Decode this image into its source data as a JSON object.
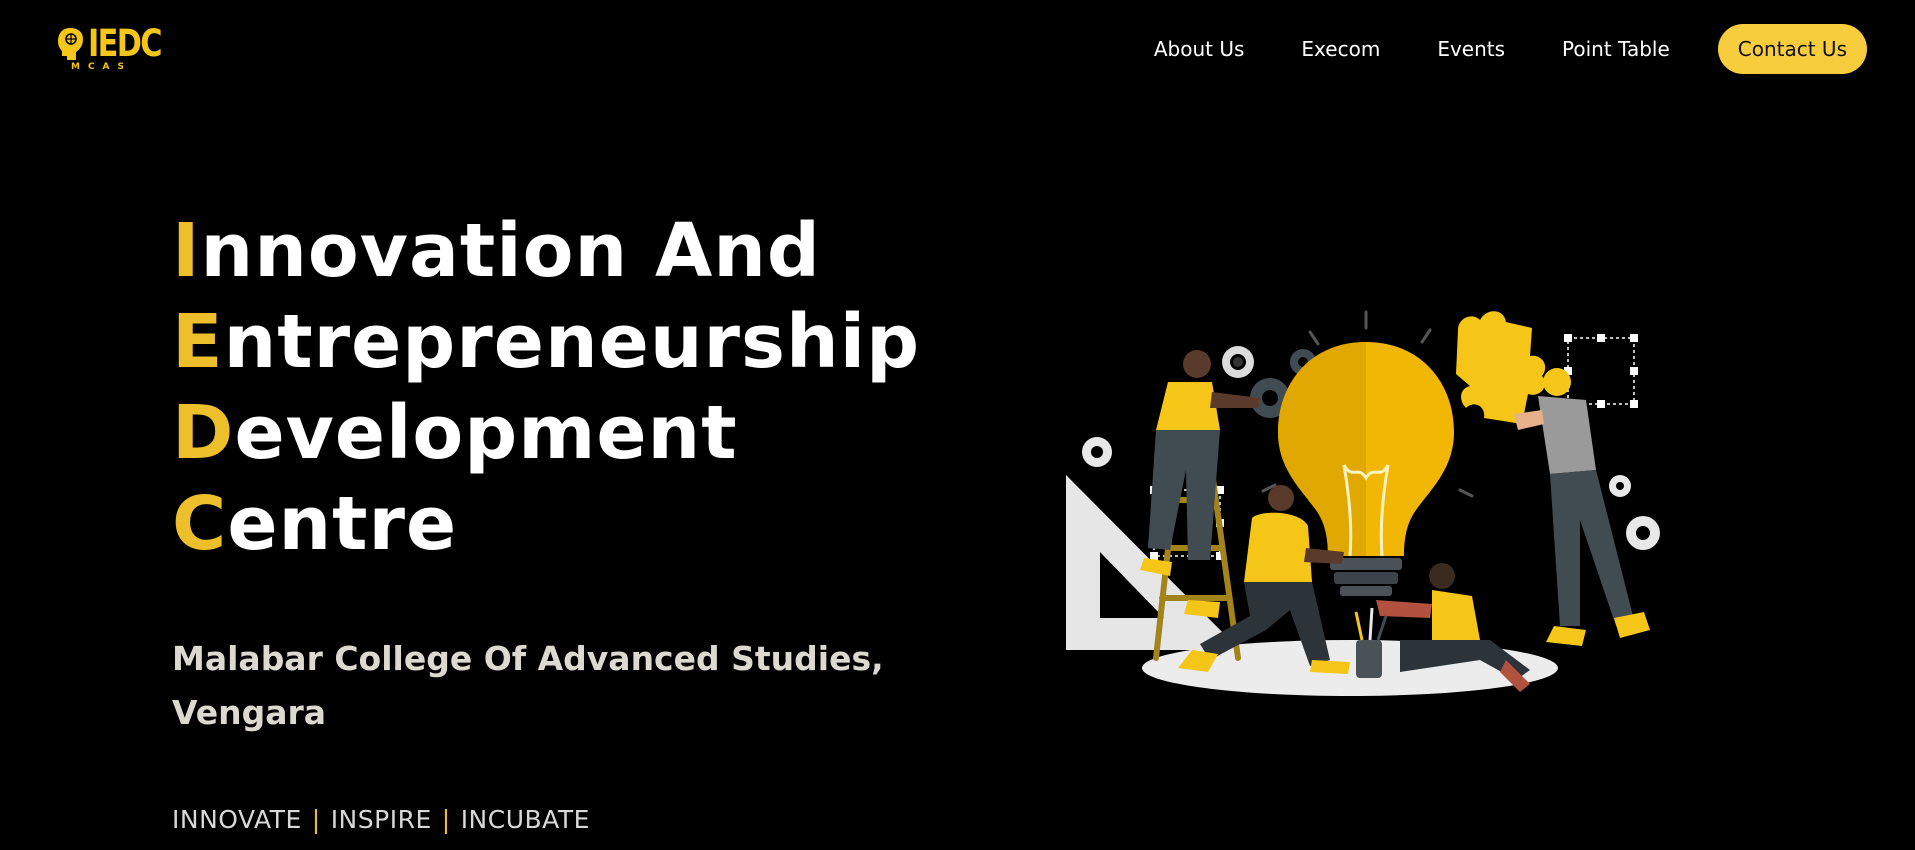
{
  "brand": {
    "logo_text": "IEDC",
    "logo_subtext": "MCAS",
    "accent_color": "#f5c518"
  },
  "nav": {
    "links": [
      "About Us",
      "Execom",
      "Events",
      "Point Table"
    ],
    "contact_label": "Contact Us"
  },
  "hero": {
    "title_lines": [
      {
        "initial": "I",
        "rest": "nnovation And"
      },
      {
        "initial": "E",
        "rest": "ntrepreneurship"
      },
      {
        "initial": "D",
        "rest": "evelopment"
      },
      {
        "initial": "C",
        "rest": "entre"
      }
    ],
    "subtitle": "Malabar College Of Advanced Studies, Vengara",
    "tagline": [
      "INNOVATE",
      "INSPIRE",
      "INCUBATE"
    ],
    "tagline_separator": "|"
  },
  "colors": {
    "background": "#000000",
    "accent": "#ecbf2b",
    "button": "#f8cd3d"
  }
}
